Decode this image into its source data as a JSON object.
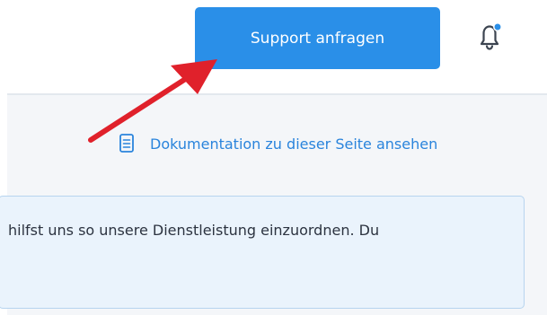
{
  "header": {
    "support_button_label": "Support anfragen",
    "notification_icon": "bell-icon",
    "notification_badge_color": "#2a8fe8"
  },
  "content": {
    "doc_link_label": "Dokumentation zu dieser Seite ansehen",
    "doc_link_icon": "document-icon",
    "info_text": "hilfst uns so unsere Dienstleistung einzuordnen. Du"
  },
  "annotation": {
    "arrow_color": "#e0212b"
  },
  "colors": {
    "accent": "#2a8fe8",
    "link": "#2a84dc",
    "info_background": "#eaf3fc",
    "info_border": "#b7d4ef"
  }
}
